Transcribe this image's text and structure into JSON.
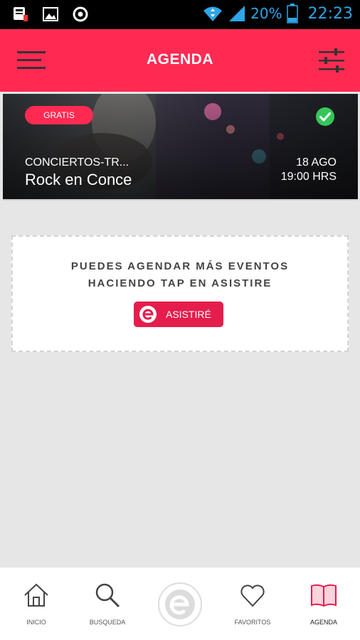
{
  "status_bar": {
    "battery": "20%",
    "time": "22:23",
    "accent_color": "#2ea6e8",
    "icons": [
      "notification-icon",
      "gallery-icon",
      "chrome-icon",
      "wifi-icon",
      "signal-icon",
      "battery-icon"
    ]
  },
  "app_bar": {
    "title": "AGENDA",
    "background": "#ff2a52",
    "left_icon": "menu-icon",
    "right_icon": "filter-sliders-icon"
  },
  "events": [
    {
      "badge": "GRATIS",
      "category": "CONCIERTOS-TR...",
      "title": "Rock en Conce",
      "date": "18 AGO",
      "time": "19:00 HRS",
      "status_icon": "check-circle-icon",
      "status_color": "#35c659"
    }
  ],
  "info": {
    "line1": "PUEDES AGENDAR MÁS EVENTOS",
    "line2": "HACIENDO TAP EN ASISTIRE",
    "button_label": "ASISTIRÉ",
    "button_color": "#e41d4c"
  },
  "bottom_nav": {
    "items": [
      {
        "label": "INICIO",
        "icon": "home-icon"
      },
      {
        "label": "BUSQUEDA",
        "icon": "search-icon"
      },
      {
        "label": "",
        "icon": "app-logo-icon"
      },
      {
        "label": "FAVORITOS",
        "icon": "heart-icon"
      },
      {
        "label": "AGENDA",
        "icon": "book-icon"
      }
    ],
    "active": "AGENDA",
    "active_color": "#e41d4c"
  }
}
